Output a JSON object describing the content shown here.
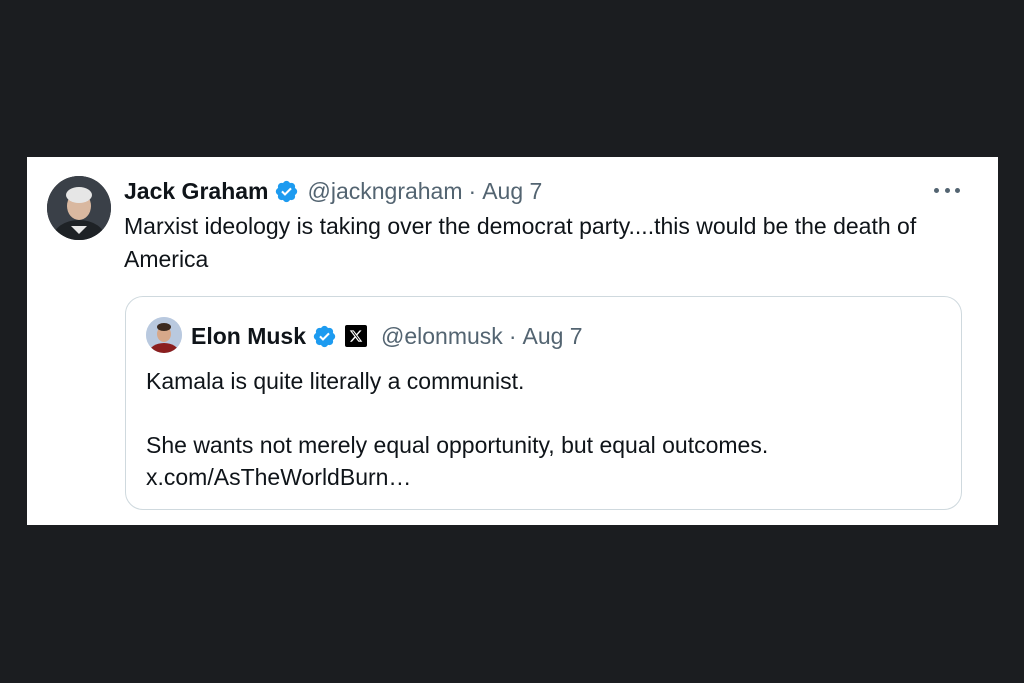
{
  "tweet": {
    "author_name": "Jack Graham",
    "handle": "@jackngraham",
    "separator": "·",
    "date": "Aug 7",
    "text": "Marxist ideology is taking over the democrat party....this would be the death of America",
    "verified_badge_color": "#1d9bf0",
    "avatar_icon": "profile-photo"
  },
  "quote": {
    "author_name": "Elon Musk",
    "handle": "@elonmusk",
    "separator": "·",
    "date": "Aug 7",
    "line1": "Kamala is quite literally a communist.",
    "line2": "She wants not merely equal opportunity, but equal outcomes.",
    "link": "x.com/AsTheWorldBurn…",
    "affiliate_icon": "x-logo-icon",
    "avatar_icon": "profile-photo"
  },
  "colors": {
    "background": "#1b1d20",
    "card": "#ffffff",
    "primary_text": "#0f1419",
    "secondary_text": "#536471",
    "border": "#cfd9de"
  }
}
